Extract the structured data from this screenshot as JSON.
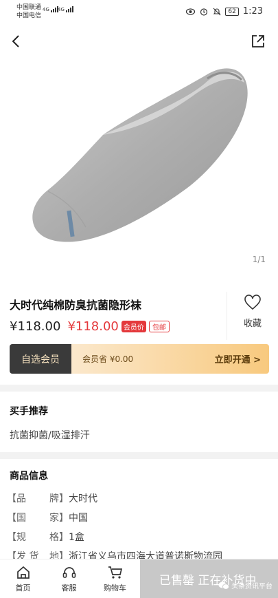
{
  "status_bar": {
    "carrier1": "中国联通",
    "carrier2": "中国电信",
    "network": "4G",
    "battery": "62",
    "time": "1:23"
  },
  "product": {
    "pager": "1/1",
    "title": "大时代纯棉防臭抗菌隐形袜",
    "price": "¥118.00",
    "vip_price": "¥118.00",
    "vip_tag": "会员价",
    "ship_tag": "包邮",
    "fav_label": "收藏"
  },
  "member": {
    "left_label": "自选会员",
    "saving_text": "会员省 ¥0.00",
    "open_label": "立即开通 >"
  },
  "recommend": {
    "title": "买手推荐",
    "text": "抗菌抑菌/吸湿排汗"
  },
  "info": {
    "title": "商品信息",
    "rows": [
      {
        "k1": "【品",
        "k2": "牌】",
        "value": "大时代"
      },
      {
        "k1": "【国",
        "k2": "家】",
        "value": "中国"
      },
      {
        "k1": "【规",
        "k2": "格】",
        "value": "1盒"
      },
      {
        "k1": "【发 货",
        "k2": "地】",
        "value": "浙江省义乌市四海大道普诺斯物流园"
      }
    ]
  },
  "bottom_nav": {
    "home": "首页",
    "service": "客服",
    "cart": "购物车",
    "soldout": "已售罄 正在补货中",
    "watermark": "头条资讯平台"
  }
}
